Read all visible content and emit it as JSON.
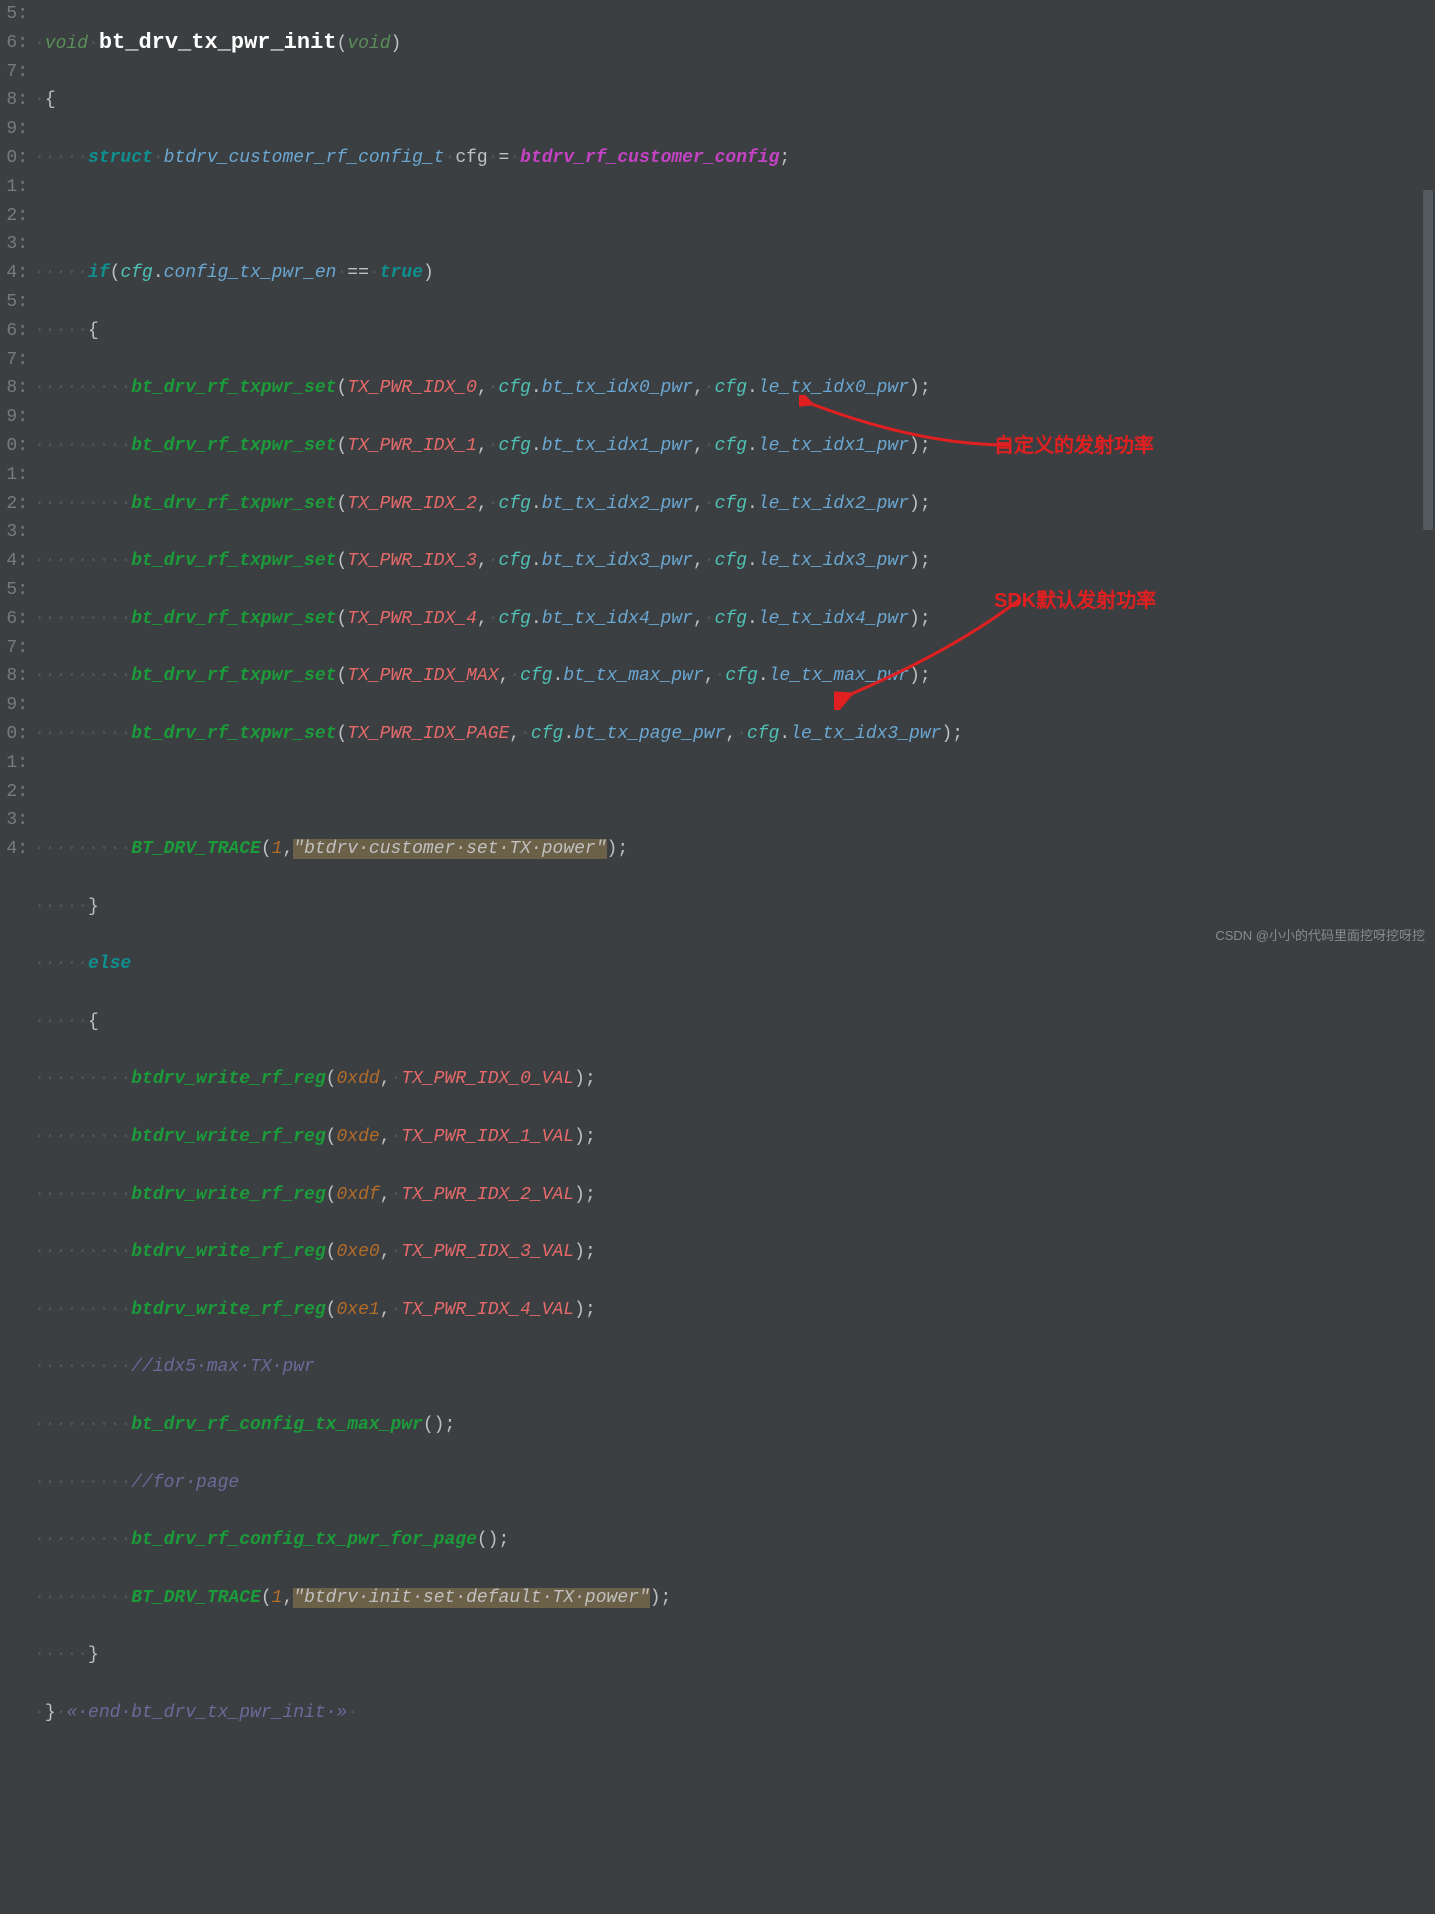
{
  "gutter": [
    "5:",
    "6:",
    "7:",
    "8:",
    "9:",
    "0:",
    "1:",
    "2:",
    "3:",
    "4:",
    "5:",
    "6:",
    "7:",
    "8:",
    "9:",
    "0:",
    "1:",
    "2:",
    "3:",
    "4:",
    "5:",
    "6:",
    "7:",
    "8:",
    "9:",
    "0:",
    "1:",
    "2:",
    "3:",
    "4:"
  ],
  "code": {
    "fn_name": "bt_drv_tx_pwr_init",
    "kw_void": "void",
    "kw_struct": "struct",
    "type_cfg": "btdrv_customer_rf_config_t",
    "var_cfg": "cfg",
    "gvar": "btdrv_rf_customer_config",
    "kw_if": "if",
    "member_en": "config_tx_pwr_en",
    "kw_true": "true",
    "call_set": "bt_drv_rf_txpwr_set",
    "idx": [
      "TX_PWR_IDX_0",
      "TX_PWR_IDX_1",
      "TX_PWR_IDX_2",
      "TX_PWR_IDX_3",
      "TX_PWR_IDX_4",
      "TX_PWR_IDX_MAX",
      "TX_PWR_IDX_PAGE"
    ],
    "bt_members": [
      "bt_tx_idx0_pwr",
      "bt_tx_idx1_pwr",
      "bt_tx_idx2_pwr",
      "bt_tx_idx3_pwr",
      "bt_tx_idx4_pwr",
      "bt_tx_max_pwr",
      "bt_tx_page_pwr"
    ],
    "le_members": [
      "le_tx_idx0_pwr",
      "le_tx_idx1_pwr",
      "le_tx_idx2_pwr",
      "le_tx_idx3_pwr",
      "le_tx_idx4_pwr",
      "le_tx_max_pwr",
      "le_tx_idx3_pwr"
    ],
    "call_trace": "BT_DRV_TRACE",
    "trace_n": "1",
    "str_custom": "\"btdrv·customer·set·TX·power\"",
    "kw_else": "else",
    "call_write": "btdrv_write_rf_reg",
    "addrs": [
      "0xdd",
      "0xde",
      "0xdf",
      "0xe0",
      "0xe1"
    ],
    "vals": [
      "TX_PWR_IDX_0_VAL",
      "TX_PWR_IDX_1_VAL",
      "TX_PWR_IDX_2_VAL",
      "TX_PWR_IDX_3_VAL",
      "TX_PWR_IDX_4_VAL"
    ],
    "cmt_idx5": "//idx5·max·TX·pwr",
    "call_max": "bt_drv_rf_config_tx_max_pwr",
    "cmt_page": "//for·page",
    "call_page": "bt_drv_rf_config_tx_pwr_for_page",
    "str_default": "\"btdrv·init·set·default·TX·power\"",
    "cmt_end": "«·end·bt_drv_tx_pwr_init·»"
  },
  "annotations": {
    "a1": "自定义的发射功率",
    "a2": "SDK默认发射功率"
  },
  "watermark": "CSDN @小小的代码里面挖呀挖呀挖"
}
